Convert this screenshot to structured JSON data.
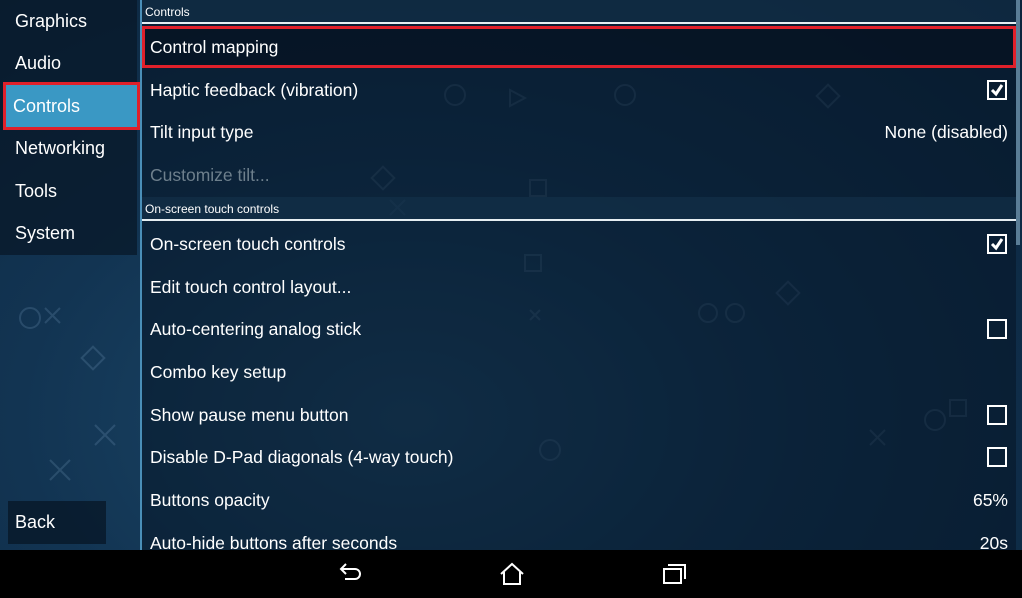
{
  "sidebar": {
    "items": [
      {
        "label": "Graphics"
      },
      {
        "label": "Audio"
      },
      {
        "label": "Controls",
        "selected": true
      },
      {
        "label": "Networking"
      },
      {
        "label": "Tools"
      },
      {
        "label": "System"
      }
    ],
    "back": "Back"
  },
  "sections": [
    {
      "header": "Controls",
      "rows": [
        {
          "label": "Control mapping",
          "highlighted": true
        },
        {
          "label": "Haptic feedback (vibration)",
          "checkbox": true
        },
        {
          "label": "Tilt input type",
          "value": "None (disabled)"
        },
        {
          "label": "Customize tilt...",
          "disabled": true
        }
      ]
    },
    {
      "header": "On-screen touch controls",
      "rows": [
        {
          "label": "On-screen touch controls",
          "checkbox": true
        },
        {
          "label": "Edit touch control layout..."
        },
        {
          "label": "Auto-centering analog stick",
          "checkbox": false
        },
        {
          "label": "Combo key setup"
        },
        {
          "label": "Show pause menu button",
          "checkbox": false
        },
        {
          "label": "Disable D-Pad diagonals (4-way touch)",
          "checkbox": false
        },
        {
          "label": "Buttons opacity",
          "value": "65%"
        },
        {
          "label": "Auto-hide buttons after seconds",
          "value": "20s"
        }
      ]
    }
  ],
  "navbar": {
    "icons": [
      "back-icon",
      "home-icon",
      "recent-apps-icon"
    ]
  },
  "colors": {
    "selected": "#3a98c4",
    "highlight_outline": "#e0202a"
  }
}
